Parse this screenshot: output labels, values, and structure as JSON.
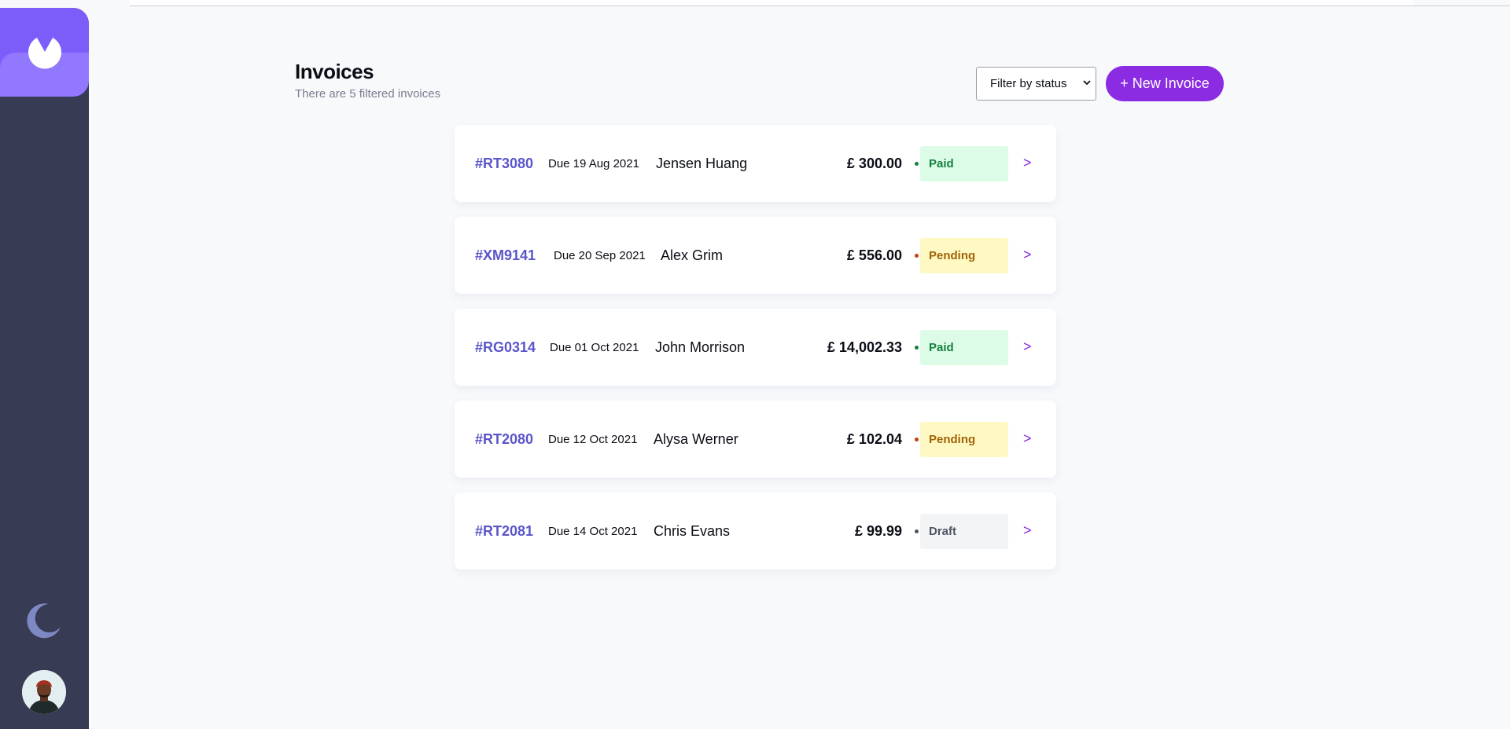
{
  "header": {
    "title": "Invoices",
    "subtitle": "There are 5 filtered invoices",
    "filter_label": "Filter by status",
    "new_invoice_label": "+ New Invoice"
  },
  "sidebar": {
    "logo_icon": "logo-icon",
    "theme_icon": "moon-icon",
    "avatar": "avatar"
  },
  "invoices": [
    {
      "id": "#RT3080",
      "due": "Due 19 Aug 2021",
      "client": "Jensen Huang",
      "amount": "£ 300.00",
      "status": "Paid"
    },
    {
      "id": "#XM9141",
      "due": "Due 20 Sep 2021",
      "client": "Alex Grim",
      "amount": "£ 556.00",
      "status": "Pending"
    },
    {
      "id": "#RG0314",
      "due": "Due 01 Oct 2021",
      "client": "John Morrison",
      "amount": "£ 14,002.33",
      "status": "Paid"
    },
    {
      "id": "#RT2080",
      "due": "Due 12 Oct 2021",
      "client": "Alysa Werner",
      "amount": "£ 102.04",
      "status": "Pending"
    },
    {
      "id": "#RT2081",
      "due": "Due 14 Oct 2021",
      "client": "Chris Evans",
      "amount": "£ 99.99",
      "status": "Draft"
    }
  ],
  "row_arrow": ">",
  "colors": {
    "accent": "#8b2be2",
    "sidebar": "#373b53",
    "logo": "#7c5dfa",
    "paid": "#15803d",
    "pending": "#a16207",
    "draft": "#4b5563"
  }
}
